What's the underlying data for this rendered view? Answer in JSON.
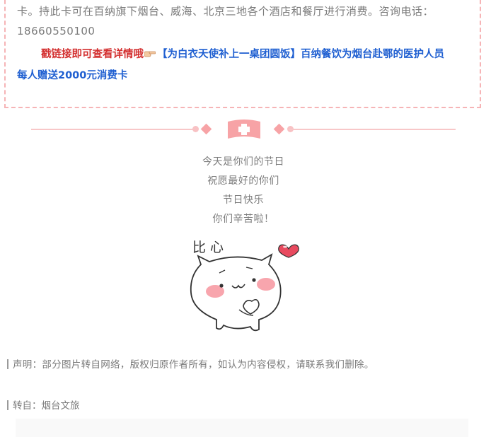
{
  "notice": {
    "text": "卡。持此卡可在百纳旗下烟台、威海、北京三地各个酒店和餐厅进行消费。咨询电话：18660550100",
    "link_prompt": "戳链接即可查看详情哦",
    "link_title_line1": "【为白衣天使补上一桌团圆饭】百纳餐饮为烟台赴鄂的医护人员",
    "link_title_line2": "每人赠送2000元消费卡",
    "finger_icon": "pointing-hand-icon"
  },
  "divider": {
    "badge_icon": "medical-cross-icon",
    "color": "#f7a3a6"
  },
  "festival": {
    "lines": [
      "今天是你们的节日",
      "祝愿最好的你们",
      "节日快乐",
      "你们辛苦啦！"
    ]
  },
  "sticker": {
    "caption": "比  心",
    "icon": "cat-heart-sticker"
  },
  "footer": {
    "disclaimer": "声明：部分图片转自网络，版权归原作者所有，如认为内容侵权，请联系我们删除。",
    "source": "转自：烟台文旅"
  },
  "colors": {
    "accent_pink": "#f7a3a6",
    "link_red": "#d32f2f",
    "link_blue": "#1f5fd1",
    "body_text": "#7a7a7a"
  }
}
